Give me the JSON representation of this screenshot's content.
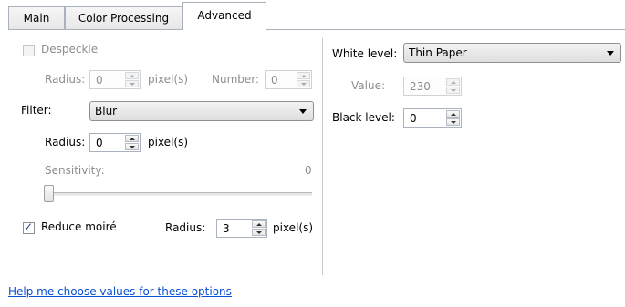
{
  "tabs": [
    {
      "label": "Main",
      "active": false
    },
    {
      "label": "Color Processing",
      "active": false
    },
    {
      "label": "Advanced",
      "active": true
    }
  ],
  "despeckle": {
    "label": "Despeckle",
    "checked": false,
    "enabled": false,
    "radius_label": "Radius:",
    "radius_value": "0",
    "radius_unit": "pixel(s)",
    "number_label": "Number:",
    "number_value": "0"
  },
  "filter": {
    "label": "Filter:",
    "selected": "Blur",
    "radius_label": "Radius:",
    "radius_value": "0",
    "radius_unit": "pixel(s)",
    "sensitivity_label": "Sensitivity:",
    "sensitivity_value": "0"
  },
  "reduce_moire": {
    "label": "Reduce moiré",
    "checked": true,
    "radius_label": "Radius:",
    "radius_value": "3",
    "radius_unit": "pixel(s)"
  },
  "white_level": {
    "label": "White level:",
    "selected": "Thin Paper",
    "value_label": "Value:",
    "value": "230"
  },
  "black_level": {
    "label": "Black level:",
    "value": "0"
  },
  "help_link": "Help me choose values for these options",
  "colors": {
    "link": "#0b4fd4",
    "disabled_text": "#8d8d8d",
    "check_mark": "#1d3f85"
  }
}
